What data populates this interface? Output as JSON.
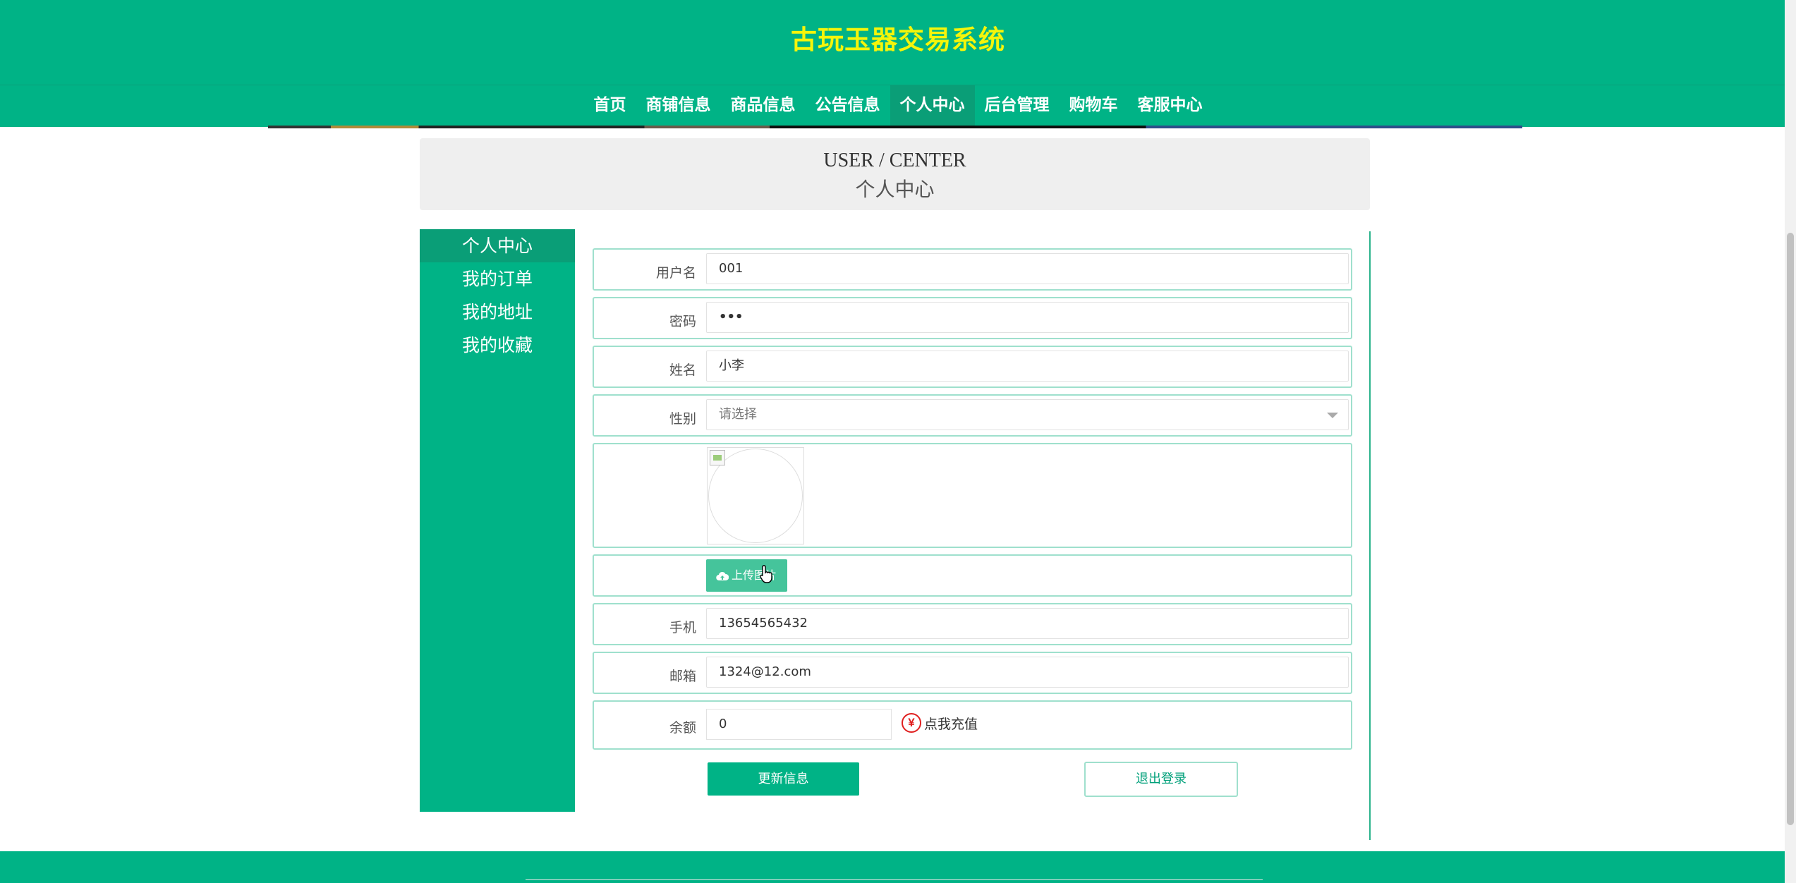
{
  "header": {
    "site_title": "古玩玉器交易系统",
    "nav": [
      {
        "label": "首页",
        "active": false
      },
      {
        "label": "商铺信息",
        "active": false
      },
      {
        "label": "商品信息",
        "active": false
      },
      {
        "label": "公告信息",
        "active": false
      },
      {
        "label": "个人中心",
        "active": true
      },
      {
        "label": "后台管理",
        "active": false
      },
      {
        "label": "购物车",
        "active": false
      },
      {
        "label": "客服中心",
        "active": false
      }
    ]
  },
  "page_title": {
    "en": "USER / CENTER",
    "cn": "个人中心"
  },
  "sidebar": {
    "items": [
      {
        "label": "个人中心",
        "active": true
      },
      {
        "label": "我的订单",
        "active": false
      },
      {
        "label": "我的地址",
        "active": false
      },
      {
        "label": "我的收藏",
        "active": false
      }
    ]
  },
  "form": {
    "username": {
      "label": "用户名",
      "value": "001"
    },
    "password": {
      "label": "密码",
      "value": "•••"
    },
    "name": {
      "label": "姓名",
      "value": "小李"
    },
    "gender": {
      "label": "性别",
      "value": "请选择"
    },
    "upload_label": "上传图片",
    "phone": {
      "label": "手机",
      "value": "13654565432"
    },
    "email": {
      "label": "邮箱",
      "value": "1324@12.com"
    },
    "balance": {
      "label": "余额",
      "value": "0"
    },
    "recharge_label": "点我充值",
    "recharge_icon": "¥"
  },
  "buttons": {
    "update": "更新信息",
    "logout": "退出登录"
  },
  "colors": {
    "primary": "#00b386",
    "active": "#0a9e77",
    "title": "#f5f50a"
  }
}
